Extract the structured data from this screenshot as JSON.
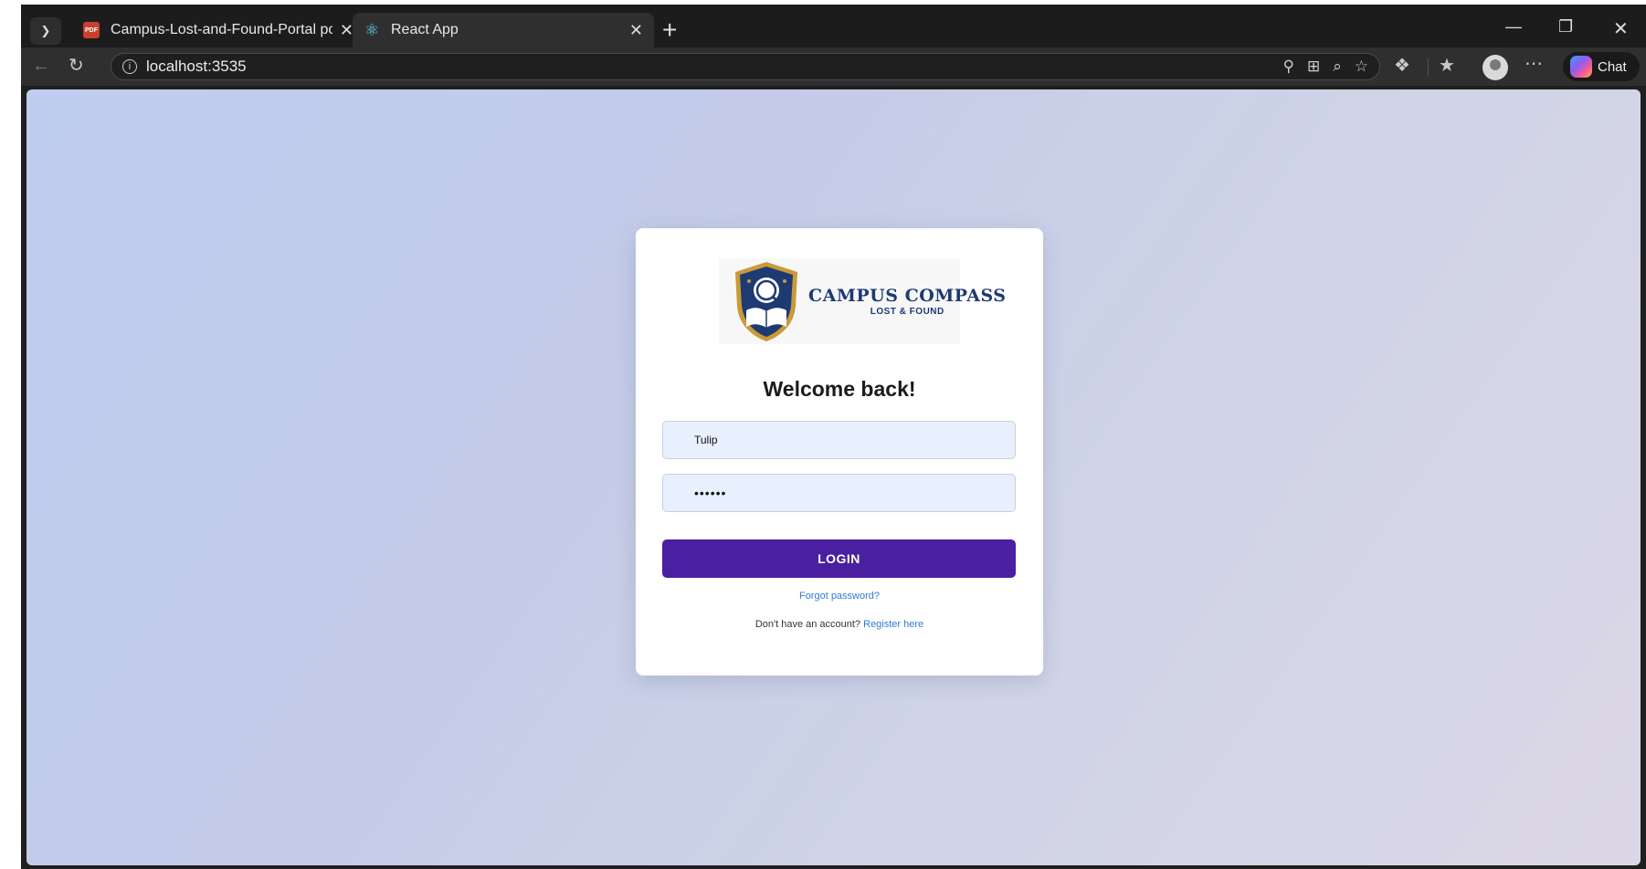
{
  "browser": {
    "tabs": [
      {
        "title": "Campus-Lost-and-Found-Portal pс",
        "icon": "pdf-icon",
        "active": false
      },
      {
        "title": "React App",
        "icon": "react-icon",
        "active": true
      }
    ],
    "address": {
      "url": "localhost:3535"
    },
    "chat_label": "Chat"
  },
  "login": {
    "logo": {
      "brand": "CAMPUS COMPASS",
      "subtitle": "LOST & FOUND"
    },
    "heading": "Welcome back!",
    "username_value": "Tulip",
    "password_value": "••••••",
    "login_label": "LOGIN",
    "forgot_label": "Forgot password?",
    "register_prompt": "Don't have an account?",
    "register_link": "Register here"
  },
  "colors": {
    "login_button": "#4a1fa0",
    "link": "#2f7bd6",
    "brand": "#1e3a72",
    "input_bg": "#e8f0fe"
  }
}
